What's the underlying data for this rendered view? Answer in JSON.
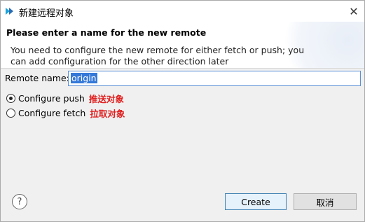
{
  "window": {
    "title": "新建远程对象",
    "close_glyph": "✕",
    "app_icon": "eclipse-git-icon"
  },
  "header": {
    "title": "Please enter a name for the new remote",
    "description": "You need to configure the new remote for either fetch or push; you can add configuration for the other direction later"
  },
  "form": {
    "name_label": "Remote name:",
    "name_value": "origin",
    "options": [
      {
        "label": "Configure push",
        "annotation": "推送对象",
        "checked": true
      },
      {
        "label": "Configure fetch",
        "annotation": "拉取对象",
        "checked": false
      }
    ]
  },
  "footer": {
    "help_glyph": "?",
    "create_label": "Create",
    "cancel_label": "取消"
  },
  "colors": {
    "accent": "#3478d8",
    "annotation": "#e02020",
    "default_button_border": "#3c7fb1"
  }
}
